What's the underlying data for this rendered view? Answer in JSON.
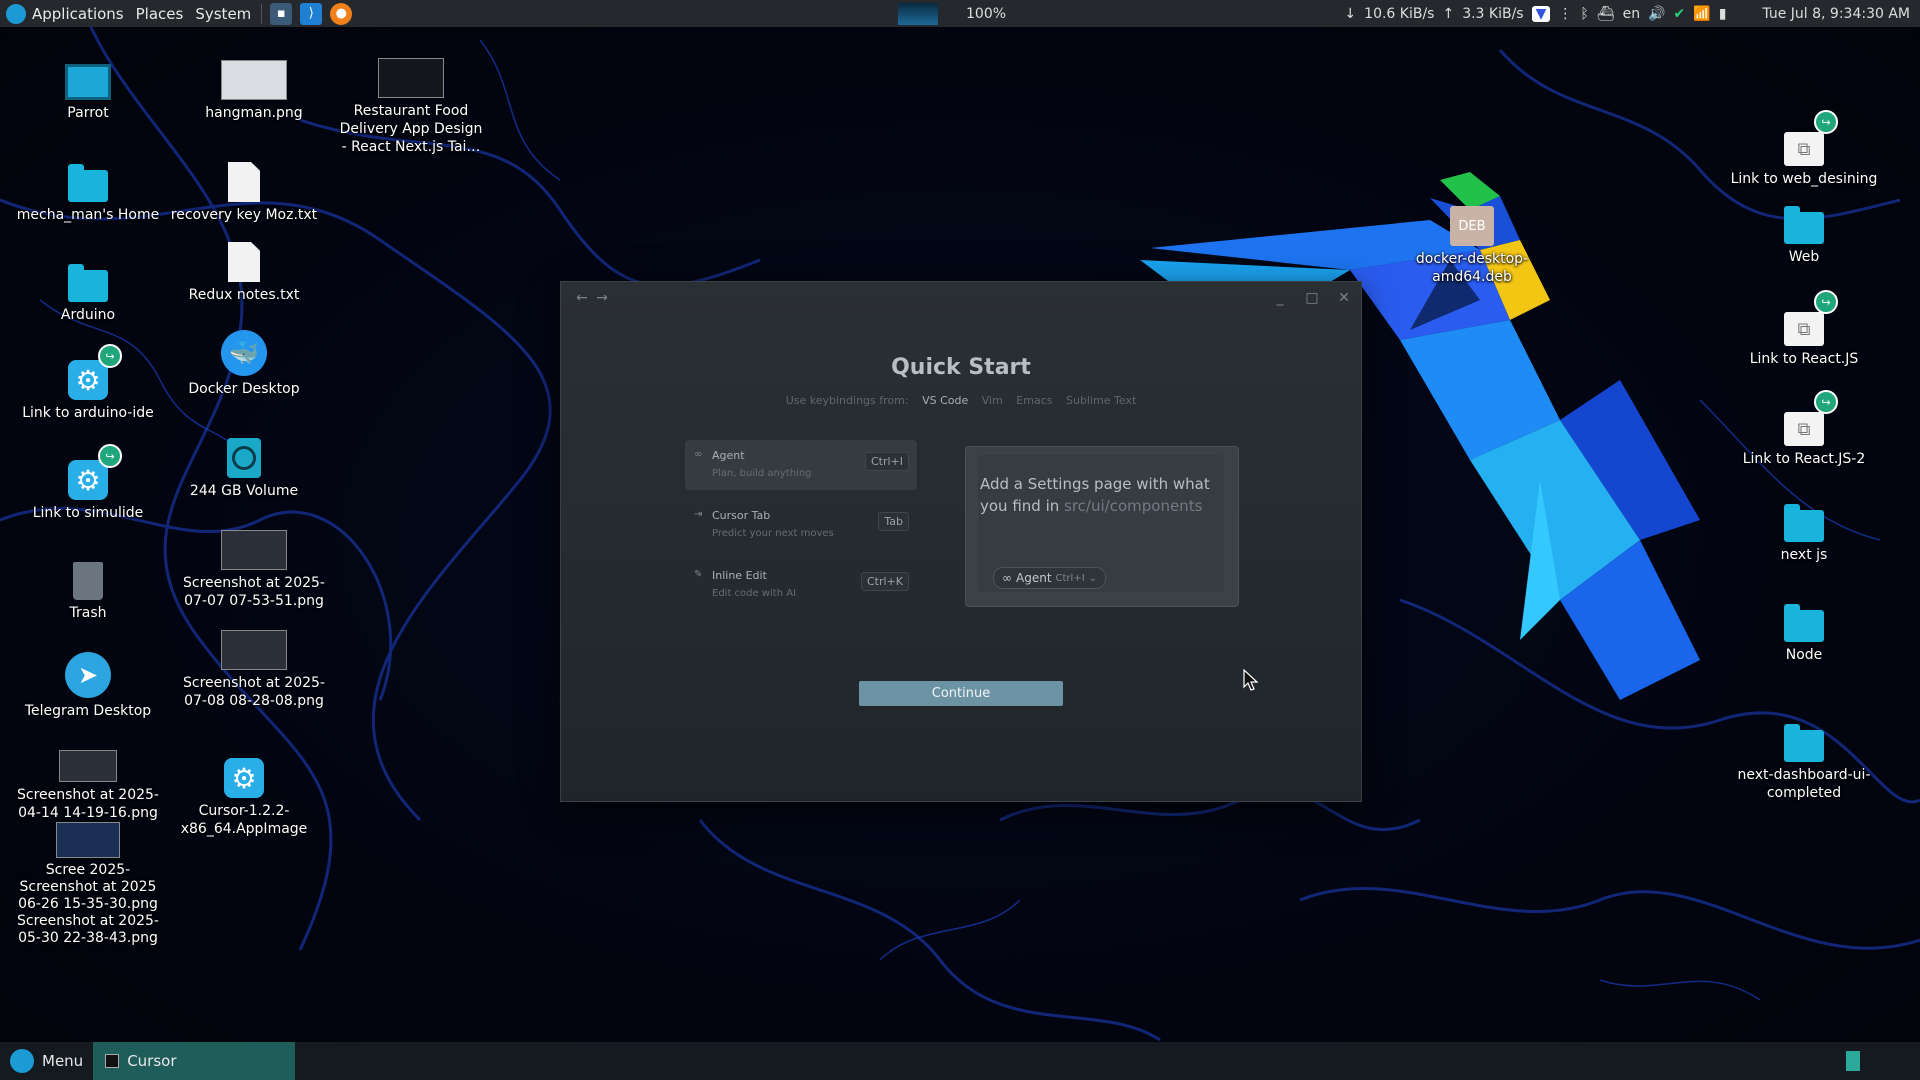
{
  "top_panel": {
    "applications": "Applications",
    "places": "Places",
    "system": "System",
    "cpu_percent": "100%",
    "net_down": "10.6 KiB/s",
    "net_up": "3.3 KiB/s",
    "keyboard_layout": "en",
    "clock": "Tue Jul 8,  9:34:30 AM"
  },
  "desktop_icons": {
    "parrot": "Parrot",
    "home": "mecha_man's Home",
    "arduino": "Arduino",
    "link_arduino": "Link to arduino-ide",
    "link_simulide": "Link to simulide",
    "trash": "Trash",
    "telegram": "Telegram Desktop",
    "shot_0414": "Screenshot at 2025-04-14 14-19-16.png",
    "overlap_stack": "Scree 2025-\nScreenshot at 2025\n06-26 15-35-30.png\nScreenshot at 2025-\n05-30 22-38-43.png",
    "hangman": "hangman.png",
    "recovery": "recovery key Moz.txt",
    "redux": "Redux notes.txt",
    "docker": "Docker Desktop",
    "volume": "244 GB Volume",
    "shot_0707": "Screenshot at 2025-07-07 07-53-51.png",
    "shot_0708": "Screenshot at 2025-07-08 08-28-08.png",
    "cursor_appimage": "Cursor-1.2.2-x86_64.AppImage",
    "restaurant": "Restaurant Food Delivery App Design - React Next.js Tai…",
    "docker_deb": "docker-desktop-amd64.deb",
    "deb_badge": "DEB",
    "link_web": "Link to web_desining",
    "web": "Web",
    "link_react": "Link to React.JS",
    "link_react2": "Link to React.JS-2",
    "nextjs": "next js",
    "node": "Node",
    "next_dashboard": "next-dashboard-ui-completed"
  },
  "cursor_window": {
    "title": "Quick Start",
    "keybind_prefix": "Use keybindings from:",
    "keybind_options": [
      "VS Code",
      "Vim",
      "Emacs",
      "Sublime Text"
    ],
    "modes": [
      {
        "name": "Agent",
        "desc": "Plan, build anything",
        "key": "Ctrl+I",
        "icon": "infinity-icon"
      },
      {
        "name": "Cursor Tab",
        "desc": "Predict your next moves",
        "key": "Tab",
        "icon": "arrow-right-icon"
      },
      {
        "name": "Inline Edit",
        "desc": "Edit code with AI",
        "key": "Ctrl+K",
        "icon": "pencil-icon"
      }
    ],
    "prompt_text": "Add a Settings page with what you find in ",
    "prompt_path": "src/ui/components",
    "agent_chip_label": "Agent",
    "agent_chip_key": "Ctrl+I",
    "continue_label": "Continue"
  },
  "bottom_panel": {
    "menu_label": "Menu",
    "task_label": "Cursor"
  },
  "colors": {
    "panel_bg": "#25282c",
    "folder": "#19b4dc",
    "accent_button": "#6c93a3",
    "taskbar_active": "#1f5d5a"
  }
}
